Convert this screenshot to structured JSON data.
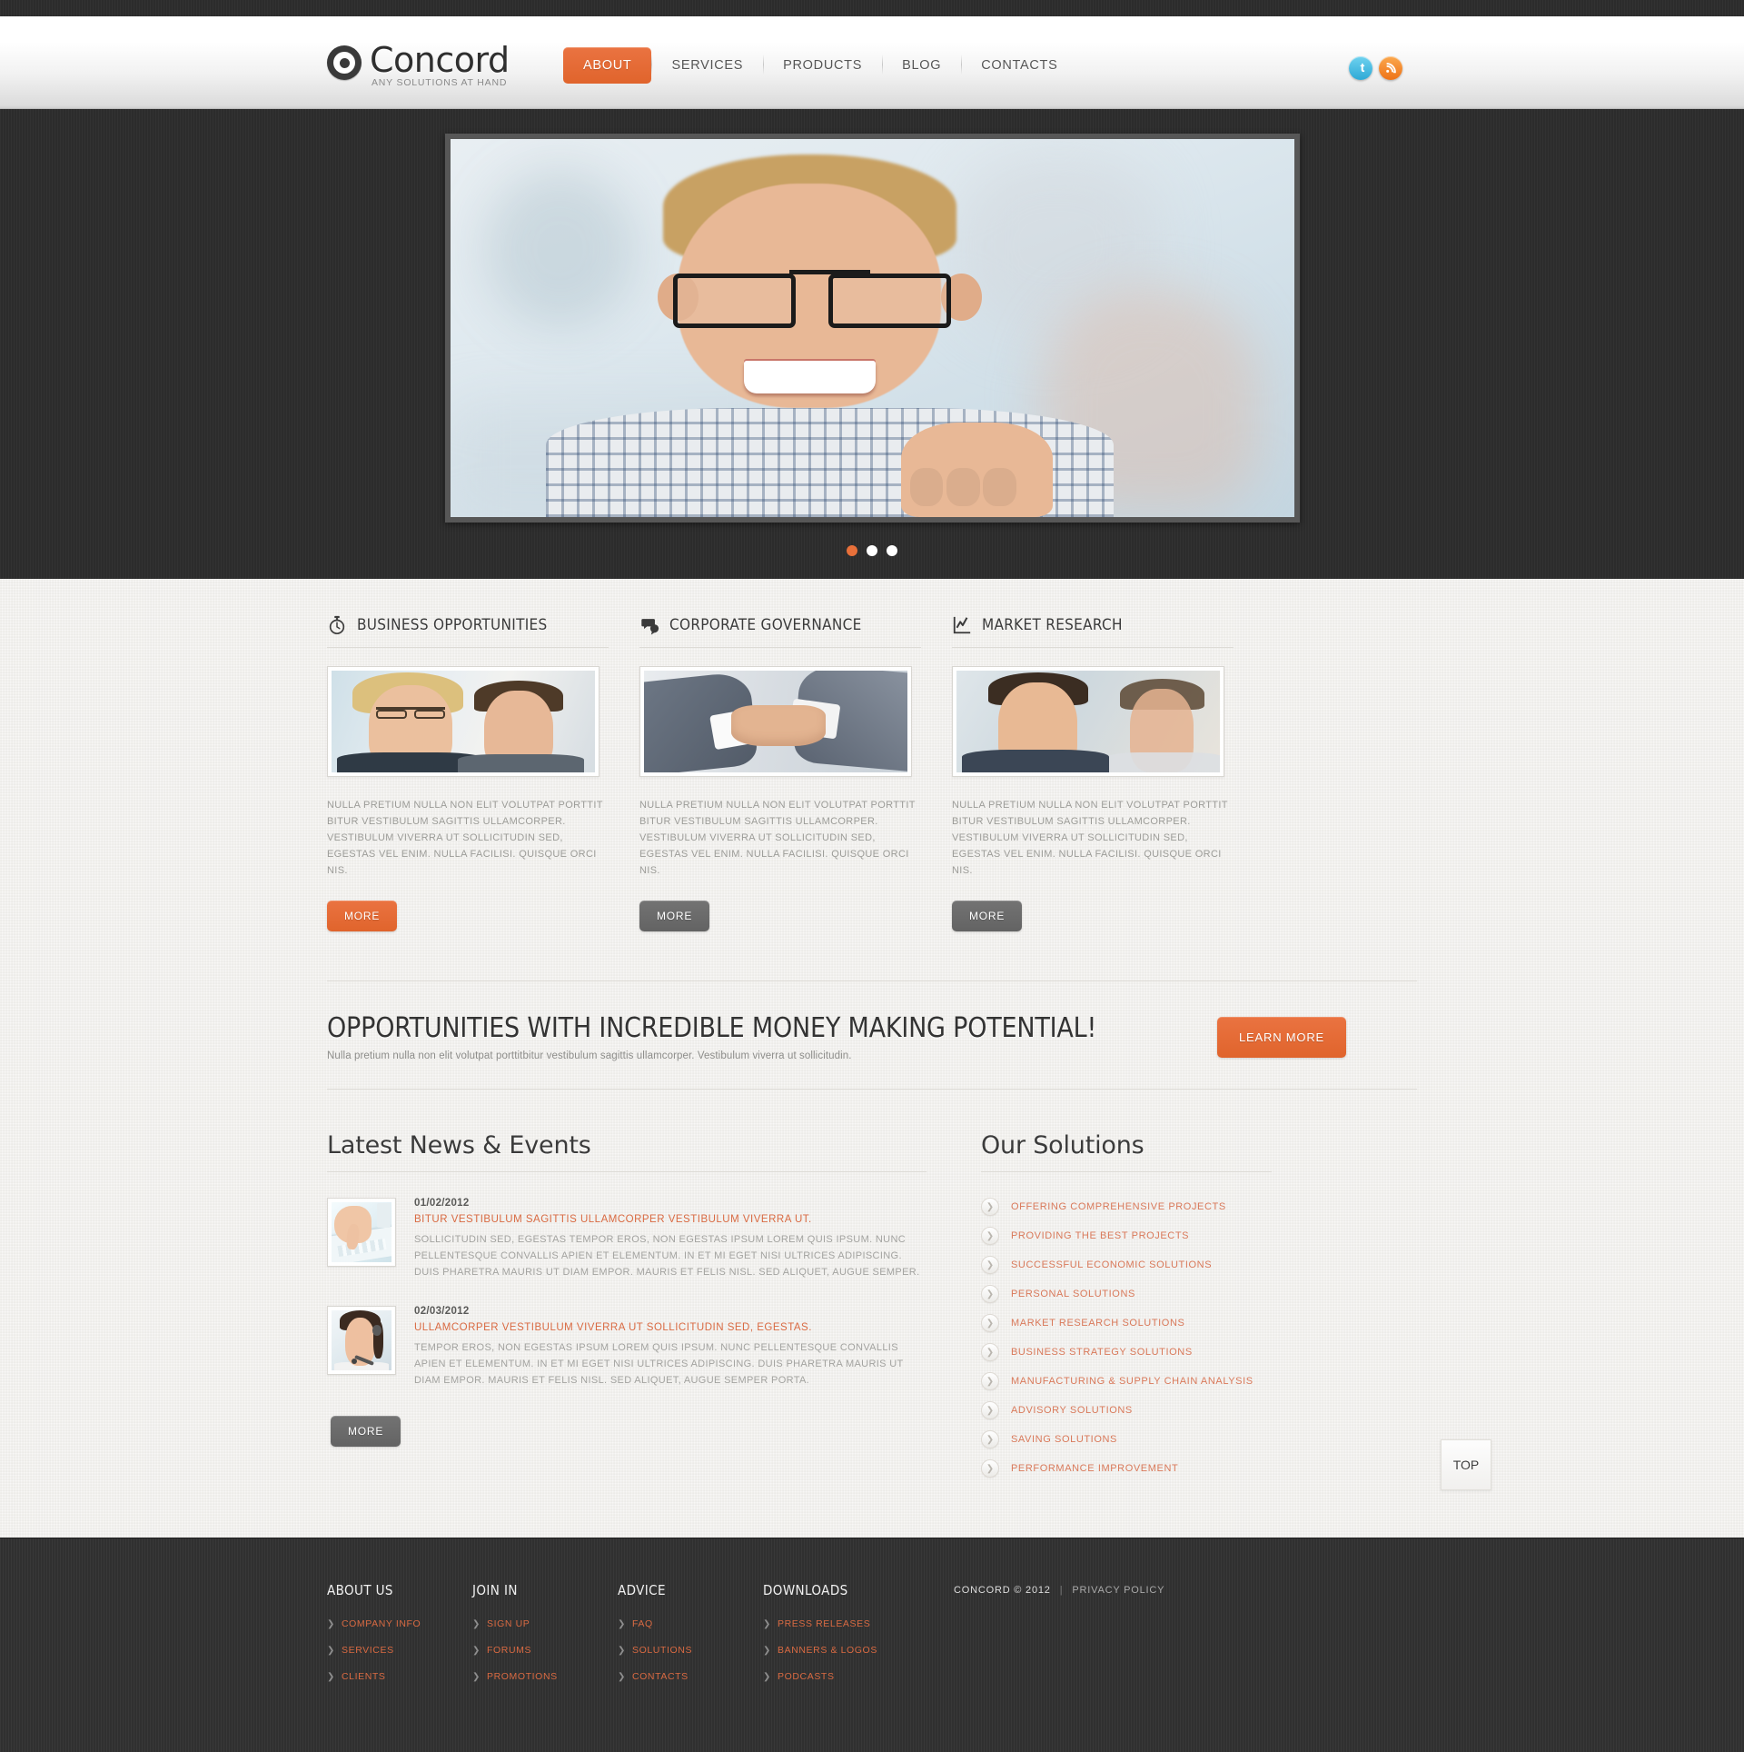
{
  "brand": {
    "name": "Concord",
    "tagline": "ANY SOLUTIONS AT HAND",
    "logo_icon": "target-circle-icon",
    "accent_color": "#e8703a"
  },
  "nav": {
    "items": [
      {
        "label": "ABOUT",
        "active": true
      },
      {
        "label": "SERVICES",
        "active": false
      },
      {
        "label": "PRODUCTS",
        "active": false
      },
      {
        "label": "BLOG",
        "active": false
      },
      {
        "label": "CONTACTS",
        "active": false
      }
    ]
  },
  "social": {
    "items": [
      {
        "name": "twitter-icon",
        "label": "t"
      },
      {
        "name": "rss-icon",
        "label": "rss"
      }
    ]
  },
  "slider": {
    "slide_alt": "Smiling young man with black glasses in office",
    "dots": [
      {
        "active": true
      },
      {
        "active": false
      },
      {
        "active": false
      }
    ]
  },
  "services": {
    "columns": [
      {
        "title": "BUSINESS OPPORTUNITIES",
        "icon": "stopwatch-icon",
        "image_alt": "Businesswoman with glasses and colleague",
        "text": "NULLA PRETIUM NULLA NON ELIT VOLUTPAT PORTTIT BITUR VESTIBULUM SAGITTIS ULLAMCORPER. VESTIBULUM VIVERRA UT SOLLICITUDIN SED, EGESTAS VEL ENIM. NULLA FACILISI. QUISQUE ORCI NIS.",
        "button": "MORE",
        "button_style": "orange"
      },
      {
        "title": "CORPORATE GOVERNANCE",
        "icon": "speech-bubbles-icon",
        "image_alt": "Two businessmen shaking hands",
        "text": "NULLA PRETIUM NULLA NON ELIT VOLUTPAT PORTTIT BITUR VESTIBULUM SAGITTIS ULLAMCORPER. VESTIBULUM VIVERRA UT SOLLICITUDIN SED, EGESTAS VEL ENIM. NULLA FACILISI. QUISQUE ORCI NIS.",
        "button": "MORE",
        "button_style": "gray"
      },
      {
        "title": "MARKET RESEARCH",
        "icon": "line-chart-icon",
        "image_alt": "Smiling man with colleagues in office",
        "text": "NULLA PRETIUM NULLA NON ELIT VOLUTPAT PORTTIT BITUR VESTIBULUM SAGITTIS ULLAMCORPER. VESTIBULUM VIVERRA UT SOLLICITUDIN SED, EGESTAS VEL ENIM. NULLA FACILISI. QUISQUE ORCI NIS.",
        "button": "MORE",
        "button_style": "gray"
      }
    ]
  },
  "promo": {
    "title": "OPPORTUNITIES WITH INCREDIBLE MONEY MAKING POTENTIAL!",
    "subtitle": "Nulla pretium nulla non elit volutpat porttitbitur vestibulum sagittis ullamcorper. Vestibulum viverra ut sollicitudin.",
    "button": "LEARN MORE"
  },
  "news": {
    "title": "Latest News & Events",
    "items": [
      {
        "date": "01/02/2012",
        "headline": "BITUR VESTIBULUM SAGITTIS ULLAMCORPER VESTIBULUM VIVERRA UT.",
        "body": "SOLLICITUDIN SED, EGESTAS TEMPOR EROS, NON EGESTAS IPSUM LOREM QUIS IPSUM. NUNC PELLENTESQUE CONVALLIS APIEN ET ELEMENTUM. IN ET MI EGET NISI ULTRICES ADIPISCING. DUIS PHARETRA MAURIS UT DIAM EMPOR. MAURIS ET FELIS NISL. SED ALIQUET, AUGUE SEMPER.",
        "image_alt": "Hand typing on a white keyboard"
      },
      {
        "date": "02/03/2012",
        "headline": "ULLAMCORPER VESTIBULUM VIVERRA UT SOLLICITUDIN SED, EGESTAS.",
        "body": "TEMPOR EROS, NON EGESTAS IPSUM LOREM QUIS IPSUM. NUNC PELLENTESQUE CONVALLIS APIEN ET ELEMENTUM. IN ET MI EGET NISI ULTRICES ADIPISCING. DUIS PHARETRA MAURIS UT DIAM EMPOR. MAURIS ET FELIS NISL. SED ALIQUET, AUGUE SEMPER PORTA.",
        "image_alt": "Female support agent with headset"
      }
    ],
    "button": "MORE"
  },
  "solutions": {
    "title": "Our Solutions",
    "bullet_icon": "chevron-right-circle-icon",
    "items": [
      "OFFERING COMPREHENSIVE PROJECTS",
      "PROVIDING THE BEST PROJECTS",
      "SUCCESSFUL ECONOMIC SOLUTIONS",
      "PERSONAL SOLUTIONS",
      "MARKET RESEARCH SOLUTIONS",
      "BUSINESS STRATEGY SOLUTIONS",
      "MANUFACTURING & SUPPLY CHAIN ANALYSIS",
      "ADVISORY SOLUTIONS",
      "SAVING SOLUTIONS",
      "PERFORMANCE IMPROVEMENT"
    ]
  },
  "scroll_top": {
    "label": "TOP"
  },
  "footer": {
    "columns": [
      {
        "title": "ABOUT US",
        "links": [
          "COMPANY INFO",
          "SERVICES",
          "CLIENTS"
        ]
      },
      {
        "title": "JOIN IN",
        "links": [
          "SIGN UP",
          "FORUMS",
          "PROMOTIONS"
        ]
      },
      {
        "title": "ADVICE",
        "links": [
          "FAQ",
          "SOLUTIONS",
          "CONTACTS"
        ]
      },
      {
        "title": "DOWNLOADS",
        "links": [
          "PRESS RELEASES",
          "BANNERS & LOGOS",
          "PODCASTS"
        ]
      }
    ],
    "copyright": "CONCORD  © 2012",
    "separator": "|",
    "privacy": "PRIVACY POLICY"
  }
}
